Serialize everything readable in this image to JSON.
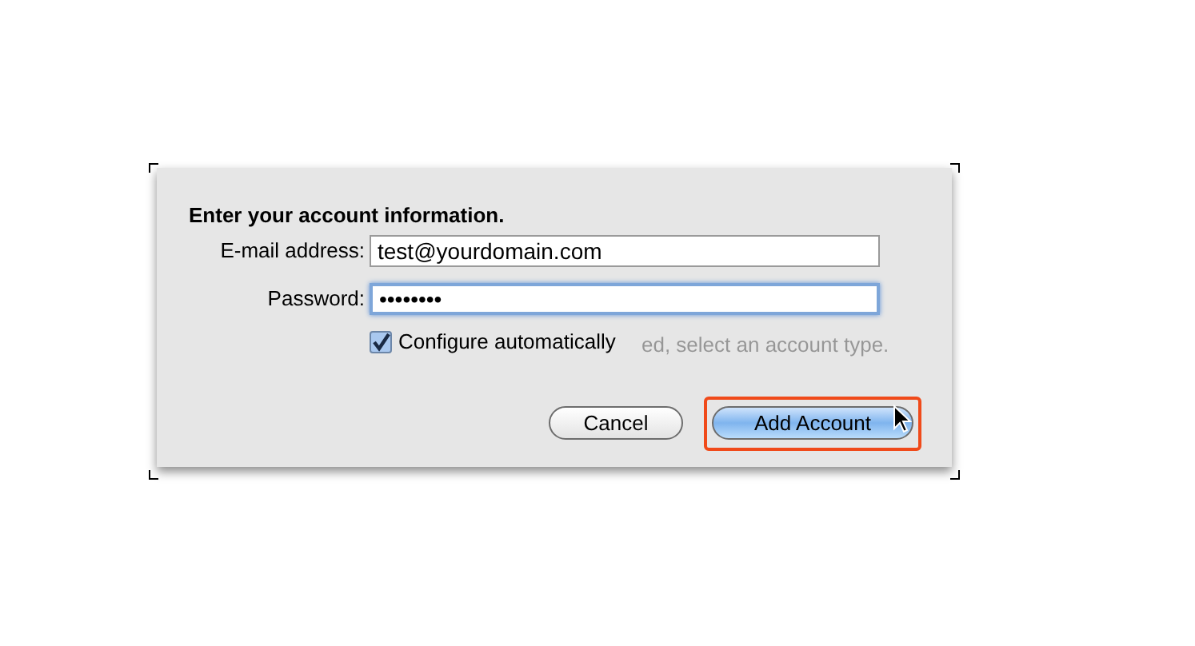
{
  "dialog": {
    "heading": "Enter your account information.",
    "fields": [
      {
        "label": "E-mail address:",
        "value": "test@yourdomain.com",
        "focused": false
      },
      {
        "label": "Password:",
        "value": "••••••••",
        "focused": true
      }
    ],
    "checkbox": {
      "label": "Configure automatically",
      "checked": true
    },
    "background_text": "ed, select an account type.",
    "buttons": [
      {
        "label": "Cancel",
        "default": false,
        "highlighted": false
      },
      {
        "label": "Add Account",
        "default": true,
        "highlighted": true
      }
    ]
  }
}
